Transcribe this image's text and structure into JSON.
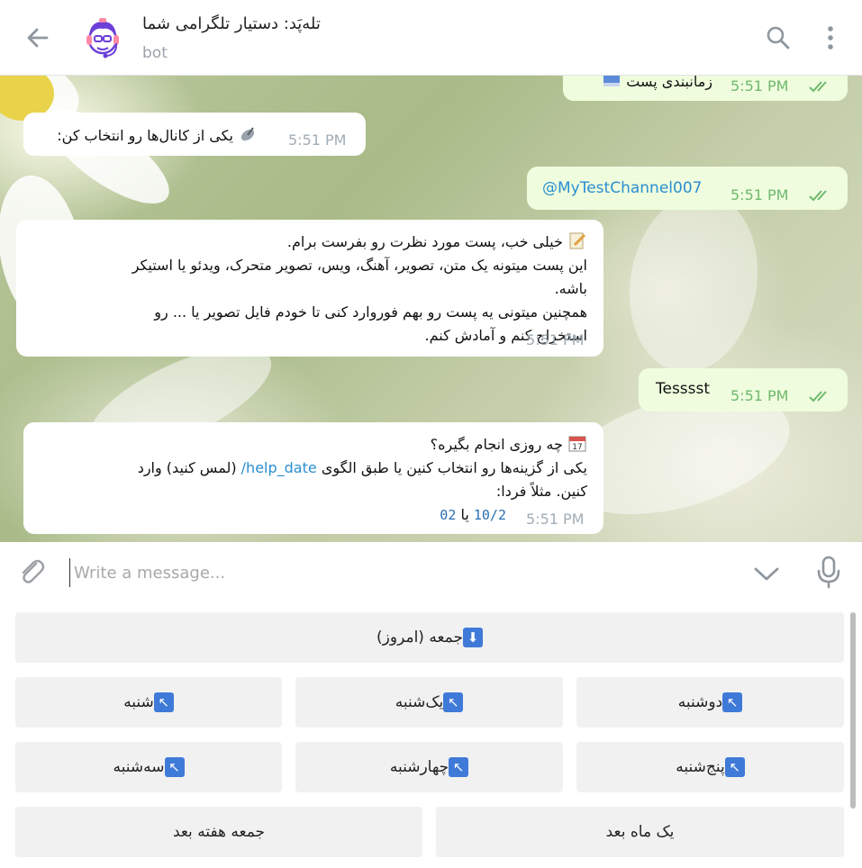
{
  "header": {
    "title": "تله‌پَد: دستیار تلگرامی شما",
    "subtitle": "bot"
  },
  "messages": [
    {
      "text": "زمانبندی پست",
      "time": "5:51 PM"
    },
    {
      "text": "یکی از کانال‌ها رو انتخاب کن:",
      "time": "5:51 PM"
    },
    {
      "text": "@MyTestChannel007",
      "time": "5:51 PM"
    },
    {
      "lines": [
        "خیلی خب، پست مورد نظرت رو بفرست برام.",
        "این پست میتونه یک متن، تصویر، آهنگ، ویس، تصویر متحرک، ویدئو یا استیکر",
        "باشه.",
        "همچنین میتونی یه پست رو بهم فوروارد کنی تا خودم فایل تصویر یا ... رو",
        "استخراج کنم و آمادش کنم."
      ],
      "time": "5:51 PM"
    },
    {
      "text": "Tesssst",
      "time": "5:51 PM"
    },
    {
      "line1": "چه روزی انجام بگیره؟",
      "line2_pre": "یکی از گزینه‌ها رو انتخاب کنین یا طبق الگوی",
      "line2_link": "/help_date",
      "line2_post": "(لمس کنید) وارد",
      "line3": "کنین. مثلاً فردا:",
      "code1": "10/2",
      "ya": "یا",
      "code2": "02",
      "time": "5:51 PM"
    }
  ],
  "composer": {
    "placeholder": "Write a message..."
  },
  "keyboard": {
    "row1": [
      "جمعه (امروز)"
    ],
    "row2": [
      "دوشنبه",
      "یک‌شنبه",
      "شنبه"
    ],
    "row3": [
      "پنج‌شنبه",
      "چهارشنبه",
      "سه‌شنبه"
    ],
    "row4": [
      "یک ماه بعد",
      "جمعه هفته بعد"
    ],
    "arrow_down": "⬇",
    "arrow_up": "↖"
  },
  "colors": {
    "accent": "#2a8fd0",
    "outgoing_bubble": "#effdde",
    "read_ticks": "#6fb86d"
  }
}
